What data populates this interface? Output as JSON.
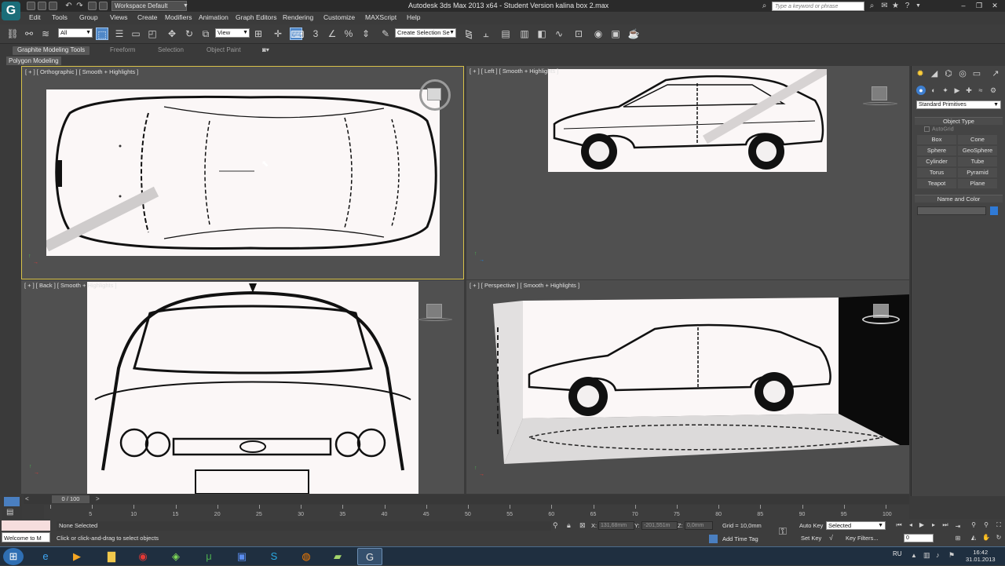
{
  "window": {
    "title": "Autodesk 3ds Max  2013 x64  - Student Version   kalina box 2.max",
    "workspace": "Workspace Default",
    "search_placeholder": "Type a keyword or phrase"
  },
  "menu": [
    "Edit",
    "Tools",
    "Group",
    "Views",
    "Create",
    "Modifiers",
    "Animation",
    "Graph Editors",
    "Rendering",
    "Customize",
    "MAXScript",
    "Help"
  ],
  "toolbar": {
    "selection_filter": "All",
    "ref_coord": "View",
    "named_selection": "Create Selection Se"
  },
  "ribbon": {
    "tabs": [
      "Graphite Modeling Tools",
      "Freeform",
      "Selection",
      "Object Paint"
    ],
    "active_tab": "Graphite Modeling Tools",
    "panel": "Polygon Modeling"
  },
  "viewports": {
    "top_left": "[ + ] [ Orthographic ] [ Smooth + Highlights ]",
    "top_right": "[ + ] [ Left ] [ Smooth + Highlights ]",
    "bottom_left": "[ + ] [ Back ] [ Smooth + Highlights ]",
    "bottom_right": "[ + ] [ Perspective ] [ Smooth + Highlights ]"
  },
  "command_panel": {
    "dropdown": "Standard Primitives",
    "object_type_title": "Object Type",
    "autogrid": "AutoGrid",
    "buttons": [
      "Box",
      "Cone",
      "Sphere",
      "GeoSphere",
      "Cylinder",
      "Tube",
      "Torus",
      "Pyramid",
      "Teapot",
      "Plane"
    ],
    "name_color_title": "Name and Color",
    "swatch_color": "#2f7ad6"
  },
  "timeline": {
    "slider": "0 / 100",
    "ticks": [
      "0",
      "5",
      "10",
      "15",
      "20",
      "25",
      "30",
      "35",
      "40",
      "45",
      "50",
      "55",
      "60",
      "65",
      "70",
      "75",
      "80",
      "85",
      "90",
      "95",
      "100"
    ]
  },
  "status": {
    "welcome": "Welcome to M",
    "selection": "None Selected",
    "prompt": "Click or click-and-drag to select objects",
    "x_label": "X:",
    "x_value": "131,68mm",
    "y_label": "Y:",
    "y_value": "-201,551m",
    "z_label": "Z:",
    "z_value": "0,0mm",
    "grid": "Grid = 10,0mm",
    "add_time_tag": "Add Time Tag",
    "auto_key": "Auto Key",
    "selected": "Selected",
    "set_key": "Set Key",
    "key_filters": "Key Filters...",
    "frame": "0"
  },
  "taskbar": {
    "language": "RU",
    "time": "16:42",
    "date": "31.01.2013"
  }
}
